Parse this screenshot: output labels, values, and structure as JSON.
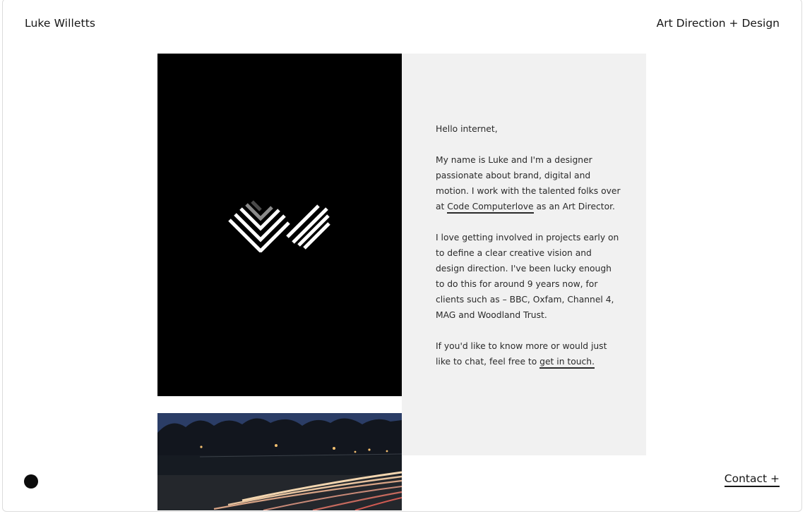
{
  "header": {
    "brand": "Luke Willetts",
    "tagline": "Art Direction + Design"
  },
  "intro": {
    "greeting": "Hello internet,",
    "p1_before": "My name is Luke and I'm a designer passionate about brand, digital and motion. I work with the talented folks over at ",
    "p1_link": "Code Computerlove",
    "p1_after": " as an Art Director.",
    "p2": "I love getting involved in projects early on to define a clear creative vision and design direction. I've been lucky enough to do this for around 9 years now, for clients such as – BBC, Oxfam, Channel 4, MAG and Woodland Trust.",
    "p3_before": "If you'd like to know more or would just like to chat, feel free to ",
    "p3_link": "get in touch."
  },
  "footer": {
    "contact": "Contact +"
  },
  "icons": {
    "logo": "lw-chevron-logo-icon",
    "dot": "menu-dot-icon"
  },
  "colors": {
    "logo_panel": "#000000",
    "text_panel": "#f1f1f1",
    "text": "#2a2a2a"
  }
}
